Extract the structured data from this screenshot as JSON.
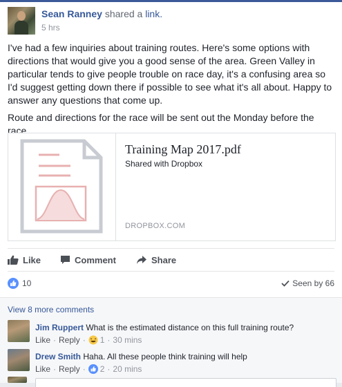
{
  "post": {
    "author": "Sean Ranney",
    "action_text": "shared a",
    "action_link": "link.",
    "timestamp": "5 hrs",
    "paragraphs": [
      "I've had a few inquiries about training routes. Here's some options with directions that would give you a good sense of the area. Green Valley in particular tends to give people trouble on race day, it's a confusing area so I'd suggest getting down there if possible to see what it's all about. Happy to answer any questions that come up.",
      "Route and directions for the race will be sent out the Monday before the race."
    ]
  },
  "link_card": {
    "title": "Training Map 2017.pdf",
    "subtitle": "Shared with Dropbox",
    "source": "DROPBOX.COM",
    "thumbnail_icon": "pdf-file-icon"
  },
  "actions": {
    "like": "Like",
    "comment": "Comment",
    "share": "Share"
  },
  "reactions": {
    "count": "10",
    "seen": "Seen by 66"
  },
  "comments": {
    "more": "View 8 more comments",
    "items": [
      {
        "name": "Jim Ruppert",
        "text": "What is the estimated distance on this full training route?",
        "like": "Like",
        "reply": "Reply",
        "reaction_icon": "laugh-emoji-icon",
        "reaction_count": "1",
        "time": "30 mins"
      },
      {
        "name": "Drew Smith",
        "text": "Haha. All these people think training will help",
        "like": "Like",
        "reply": "Reply",
        "reaction_icon": "like-icon",
        "reaction_count": "2",
        "time": "20 mins"
      }
    ]
  },
  "colors": {
    "link_blue": "#365899",
    "like_blue": "#5890ff",
    "pdf_red": "#e8b0b0",
    "doc_gray": "#c8ccd2"
  }
}
